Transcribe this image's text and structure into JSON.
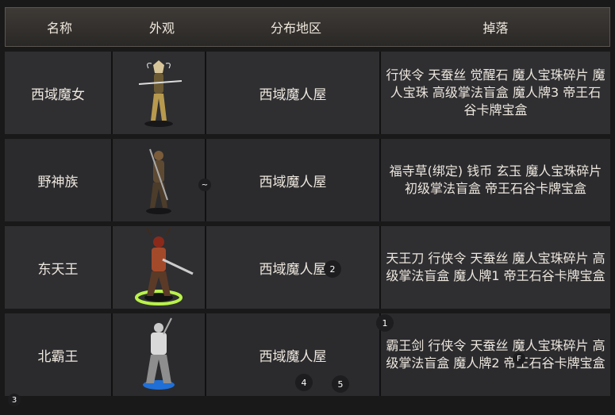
{
  "header": {
    "name": "名称",
    "look": "外观",
    "area": "分布地区",
    "drop": "掉落"
  },
  "rows": [
    {
      "name": "西域魔女",
      "area": "西域魔人屋",
      "drop": "行侠令 天蚕丝 觉醒石 魔人宝珠碎片 魔人宝珠 高级掌法盲盒 魔人牌3 帝王石谷卡牌宝盒",
      "figure_icon": "witch-figure-icon"
    },
    {
      "name": "野神族",
      "area": "西域魔人屋",
      "drop": "福寺草(绑定) 钱币 玄玉 魔人宝珠碎片 初级掌法盲盒 帝王石谷卡牌宝盒",
      "figure_icon": "wild-warrior-figure-icon"
    },
    {
      "name": "东天王",
      "area": "西域魔人屋",
      "drop": "天王刀 行侠令 天蚕丝 魔人宝珠碎片 高级掌法盲盒 魔人牌1 帝王石谷卡牌宝盒",
      "figure_icon": "east-king-figure-icon"
    },
    {
      "name": "北霸王",
      "area": "西域魔人屋",
      "drop": "霸王剑 行侠令 天蚕丝 魔人宝珠碎片 高级掌法盲盒 魔人牌2 帝王石谷卡牌宝盒",
      "figure_icon": "north-king-figure-icon"
    }
  ],
  "badges": {
    "b1": "1",
    "b2": "2",
    "b3": "3",
    "b4": "4",
    "b5": "5",
    "bF": "F",
    "tilde": "~"
  }
}
